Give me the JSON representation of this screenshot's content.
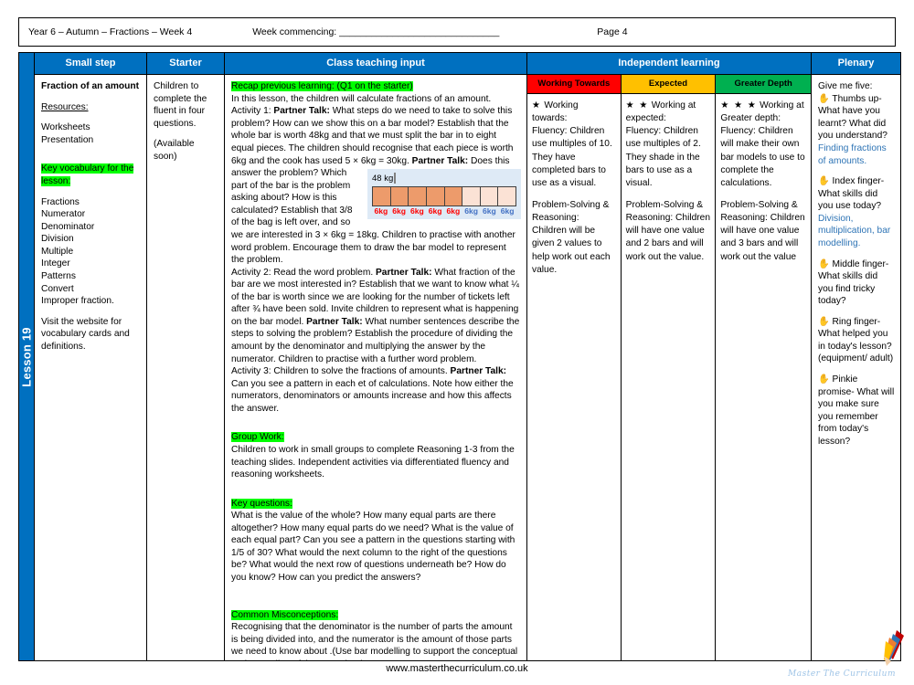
{
  "header": {
    "left": "Year 6 – Autumn – Fractions – Week 4",
    "week_commencing_label": "Week commencing: ______________________________",
    "page": "Page 4"
  },
  "spine": {
    "lesson_label": "Lesson 19"
  },
  "columns": {
    "small_step": "Small step",
    "starter": "Starter",
    "class_teaching_input": "Class teaching input",
    "independent_learning": "Independent learning",
    "plenary": "Plenary"
  },
  "independent_subheaders": {
    "working_towards": "Working Towards",
    "expected": "Expected",
    "greater_depth": "Greater Depth",
    "color_working_towards": "#FF0000",
    "color_expected": "#FFC000",
    "color_greater_depth": "#00B050"
  },
  "small_step": {
    "title": "Fraction of an amount",
    "resources_label": "Resources:",
    "resources": [
      "Worksheets",
      "Presentation"
    ],
    "vocab_heading": "Key vocabulary for the lesson:",
    "vocabulary": [
      "Fractions",
      "Numerator",
      "Denominator",
      "Division",
      "Multiple",
      "Integer",
      "Patterns",
      "Convert",
      "Improper fraction."
    ],
    "website_note": "Visit the website for vocabulary cards and definitions."
  },
  "starter": {
    "text": "Children to complete the fluent in four questions.",
    "availability": "(Available soon)"
  },
  "teaching": {
    "recap_heading": "Recap previous learning: (Q1 on the starter)",
    "intro": "In this lesson, the children will calculate fractions of an amount.",
    "activity1_pre": "Activity 1: ",
    "partner_talk": "Partner Talk:",
    "activity1_a": " What steps do we need to take to solve this problem? How can we show this on a bar model? Establish that the whole bar is worth 48kg and that we must split the bar in to eight equal pieces. The children should recognise that each piece is worth 6kg and the cook has used 5 × 6kg = 30kg. ",
    "activity1_b": " Does this answer the problem? Which part of the bar is the problem asking about? How is this calculated?  Establish that 3/8 of the bag is left over, and so we are interested in 3 × 6kg = 18kg. Children to practise with another word problem. Encourage them to draw the bar model to represent the problem.",
    "activity2_pre": "Activity 2: Read the word problem. ",
    "activity2_a": " What fraction of the bar are we most interested in?  Establish that we want to know what ¼ of the bar is worth since we are looking for the number of tickets left after ¾ have been  sold. Invite children to represent what is happening on the bar model. ",
    "activity2_b": " What number sentences describe the steps to solving the problem? Establish the procedure of dividing the amount by the denominator and multiplying the answer by the numerator. Children to practise with a further word problem.",
    "activity3_pre": "Activity 3: Children to solve the fractions of amounts. ",
    "activity3_a": "Can you see a pattern in each et of calculations. Note how either the numerators, denominators or amounts increase and how this affects the answer.",
    "group_work_heading": "Group Work:",
    "group_work_text": "Children to work in small groups to complete Reasoning 1-3 from the teaching slides. Independent activities via differentiated fluency and reasoning worksheets.",
    "key_questions_heading": "Key questions:",
    "key_questions_text": "What is the value of the whole? How many equal parts are there altogether? How many equal parts do we need? What is the value of each equal part? Can you see a pattern in the questions starting with 1/5 of 30? What would the next column to the right of the questions be? What would the next row of questions underneath be? How do you know? How can you predict the answers?",
    "misconceptions_heading": "Common Misconceptions:",
    "misconceptions_text": "Recognising that the denominator is the number of parts the amount is being divided into, and the numerator is the amount of those parts we need to know about .(Use bar modelling to support the conceptual understanding of the procedure).",
    "bar_model": {
      "whole_label": "48 kg",
      "segments": 8,
      "shaded": 5,
      "segment_labels": [
        "6kg",
        "6kg",
        "6kg",
        "6kg",
        "6kg",
        "6kg",
        "6kg",
        "6kg"
      ],
      "shaded_color": "#ED9B6B",
      "unshaded_color": "#FBE2D5",
      "shaded_label_color": "#FF0000",
      "unshaded_label_color": "#4472C4"
    }
  },
  "independent": {
    "working_towards": {
      "stars": "★",
      "star_count": 1,
      "title": "Working towards:",
      "fluency": "Fluency: Children use multiples of 10. They have completed bars to use as a visual.",
      "reasoning": "Problem-Solving & Reasoning: Children will be given 2 values to help work out each value."
    },
    "expected": {
      "stars": "★ ★",
      "star_count": 2,
      "title": "Working at expected:",
      "fluency": "Fluency: Children use multiples of 2. They shade in the bars to use as a visual.",
      "reasoning": "Problem-Solving & Reasoning: Children will have one value and 2 bars and will work out the value."
    },
    "greater_depth": {
      "stars": "★ ★ ★",
      "star_count": 3,
      "title": "Working at Greater depth:",
      "fluency": "Fluency: Children will make their own bar models to use to complete the calculations.",
      "reasoning": "Problem-Solving & Reasoning: Children will have one value and 3 bars and will work out the value"
    }
  },
  "plenary": {
    "intro": "Give me five:",
    "items": [
      {
        "icon": "hand-icon",
        "question": "Thumbs up- What have you learnt? What did you understand?",
        "answer": "Finding fractions of amounts."
      },
      {
        "icon": "hand-icon",
        "question": "Index finger- What skills did you use today?",
        "answer": "Division, multiplication, bar modelling."
      },
      {
        "icon": "hand-icon",
        "question": "Middle finger- What skills did you find tricky today?",
        "answer": ""
      },
      {
        "icon": "hand-icon",
        "question": "Ring finger- What helped you in today's lesson? (equipment/ adult)",
        "answer": ""
      },
      {
        "icon": "hand-icon",
        "question": "Pinkie promise- What will you make sure you remember from today's lesson?",
        "answer": ""
      }
    ],
    "answer_color": "#2E74B5"
  },
  "footer": {
    "url": "www.masterthecurriculum.co.uk",
    "brand": "Master The Curriculum"
  }
}
